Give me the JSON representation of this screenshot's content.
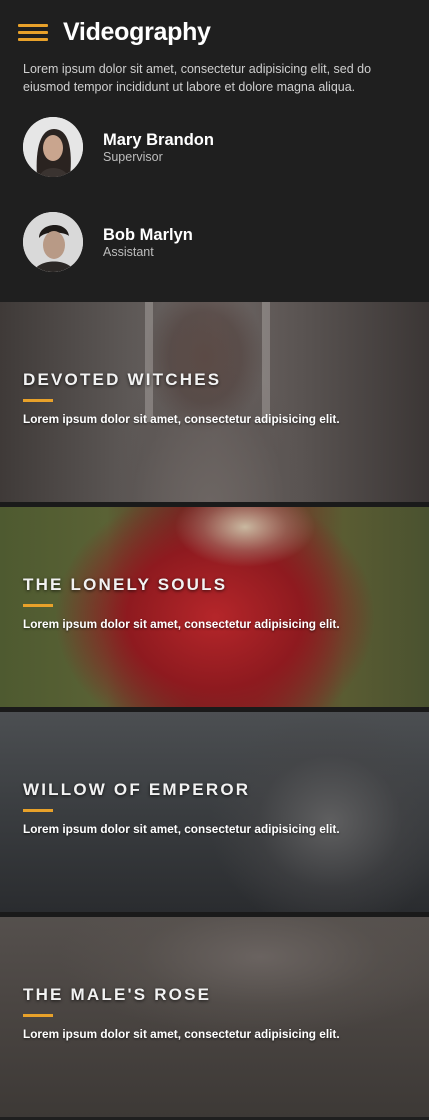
{
  "header": {
    "title": "Videography",
    "intro": "Lorem ipsum dolor sit amet, consectetur adipisicing elit, sed do eiusmod tempor incididunt ut labore et dolore magna aliqua."
  },
  "team": [
    {
      "name": "Mary Brandon",
      "role": "Supervisor"
    },
    {
      "name": "Bob Marlyn",
      "role": "Assistant"
    }
  ],
  "cards": [
    {
      "title": "DEVOTED WITCHES",
      "text": "Lorem ipsum dolor sit amet, consectetur adipisicing elit."
    },
    {
      "title": "THE LONELY SOULS",
      "text": "Lorem ipsum dolor sit amet, consectetur adipisicing elit."
    },
    {
      "title": "WILLOW OF EMPEROR",
      "text": "Lorem ipsum dolor sit amet, consectetur adipisicing elit."
    },
    {
      "title": "THE MALE'S ROSE",
      "text": "Lorem ipsum dolor sit amet, consectetur adipisicing elit."
    }
  ],
  "colors": {
    "accent": "#e8a12a",
    "background": "#1f1f1f"
  }
}
